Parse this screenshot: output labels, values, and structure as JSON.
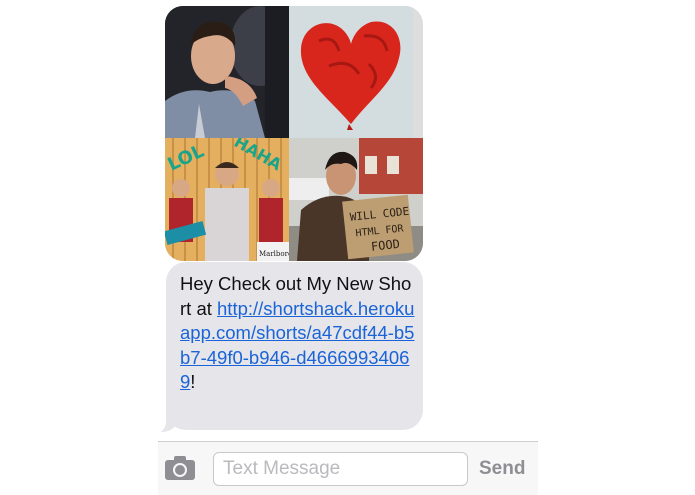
{
  "thread": {
    "photos": [
      {
        "name": "portrait-photo"
      },
      {
        "name": "red-heart-balloon-photo"
      },
      {
        "name": "lol-haha-collage-photo",
        "captions": [
          "LOL",
          "HAHA",
          "Marlboro"
        ]
      },
      {
        "name": "sign-holder-photo",
        "sign_text": [
          "WILL CODE",
          "HTML FOR",
          "FOOD"
        ]
      }
    ],
    "message": {
      "prefix": "Hey Check out My New Short at ",
      "link": "http://shortshack.herokuapp.com/shorts/a47cdf44-b5b7-49f0-b946-d46669934069",
      "suffix": "!"
    }
  },
  "composer": {
    "camera_icon": "camera-icon",
    "placeholder": "Text Message",
    "send_label": "Send"
  },
  "colors": {
    "bubble": "#e5e5ea",
    "link": "#1a64d8",
    "send": "#8e8e93"
  }
}
